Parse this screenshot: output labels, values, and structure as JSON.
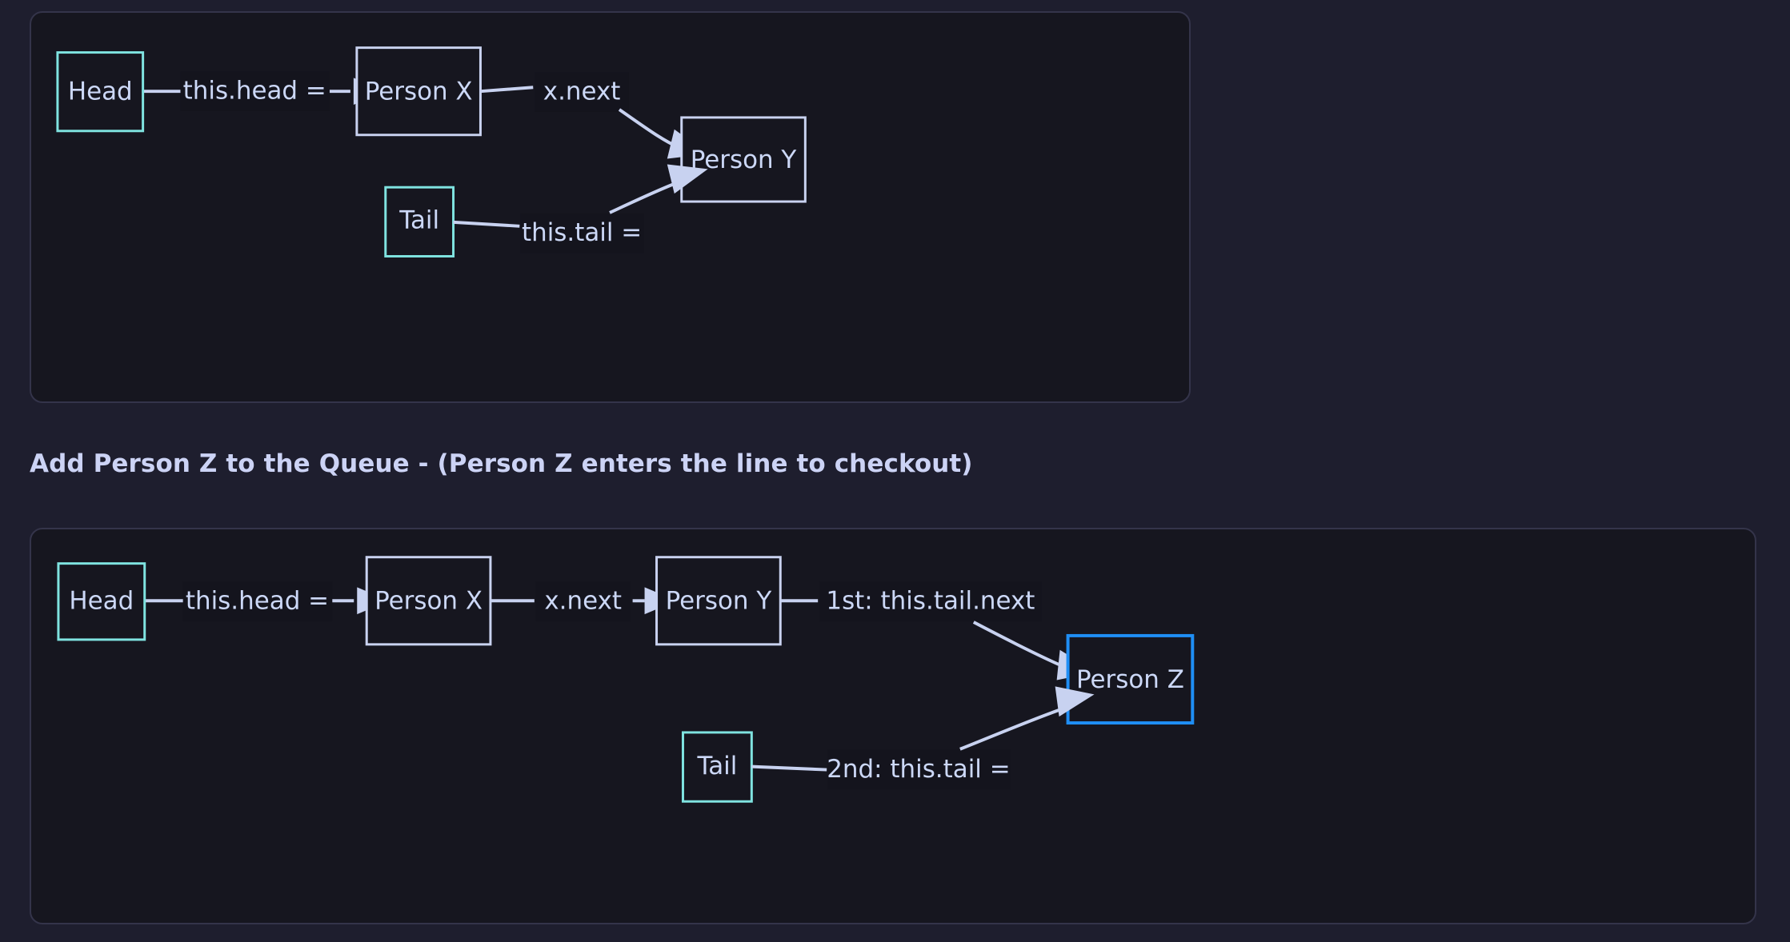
{
  "theme": {
    "page_background": "#1e1e2e",
    "panel_background": "#16161f",
    "panel_border": "#34344a",
    "text_color": "#ccd8f7",
    "heading_color": "#ccd3f5",
    "link_color": "#c8d2f0",
    "accent_cyan": "#7fe3e0",
    "accent_lavender": "#c9d2f0",
    "accent_blue": "#1f8ef5"
  },
  "heading": {
    "text": "Add Person Z to the Queue - (Person Z enters the line to checkout)"
  },
  "diagram_one": {
    "nodes": {
      "head": "Head",
      "person_x": "Person X",
      "person_y": "Person Y",
      "tail": "Tail"
    },
    "edge_labels": {
      "this_head": "this.head =",
      "x_next": "x.next",
      "this_tail": "this.tail ="
    }
  },
  "diagram_two": {
    "nodes": {
      "head": "Head",
      "person_x": "Person X",
      "person_y": "Person Y",
      "person_z": "Person Z",
      "tail": "Tail"
    },
    "edge_labels": {
      "this_head": "this.head =",
      "x_next": "x.next",
      "first_tail_next": "1st: this.tail.next",
      "second_this_tail": "2nd: this.tail ="
    }
  }
}
